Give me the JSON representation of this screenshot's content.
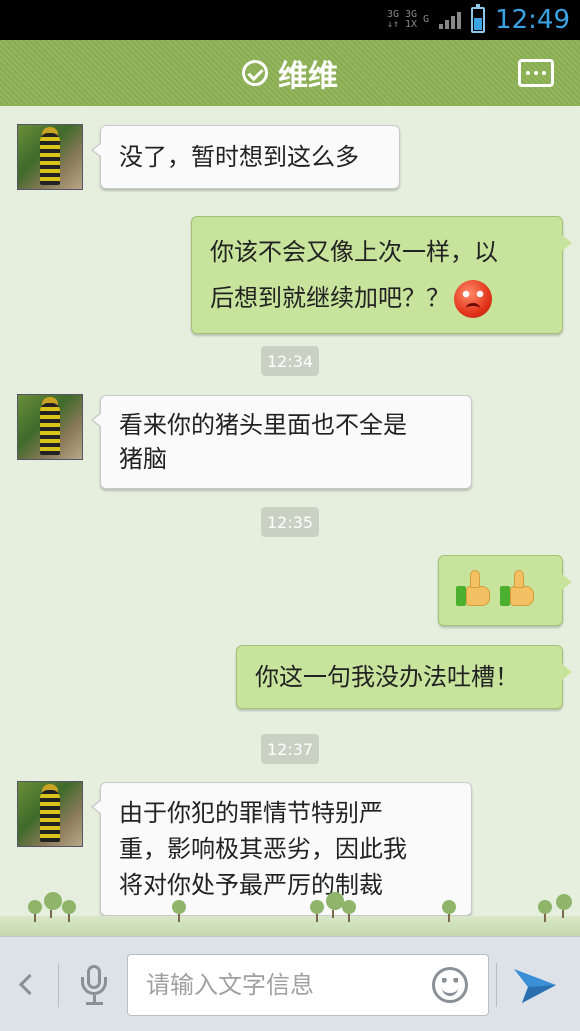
{
  "status_bar": {
    "network_labels": [
      "3G",
      "3G",
      "1X",
      "G"
    ],
    "battery_level": 0.55,
    "time": "12:49",
    "accent_color": "#3aa3e3"
  },
  "header": {
    "title": "维维",
    "verified_icon": "check-circle-icon",
    "menu_icon": "more-options-icon",
    "bg_color": "#8db255"
  },
  "messages": [
    {
      "side": "left",
      "text": "没了，暂时想到这么多"
    },
    {
      "side": "right",
      "text": "你该不会又像上次一样，以后想到就继续加吧？？",
      "line1": "你该不会又像上次一样，以",
      "line2": "后想到就继续加吧？？",
      "emoji": "angry-face-icon"
    },
    {
      "type": "time",
      "text": "12:34"
    },
    {
      "side": "left",
      "text": "看来你的猪头里面也不全是猪脑",
      "line1": "看来你的猪头里面也不全是",
      "line2": "猪脑"
    },
    {
      "type": "time",
      "text": "12:35"
    },
    {
      "side": "right",
      "emoji": [
        "thumbs-up-icon",
        "thumbs-up-icon"
      ]
    },
    {
      "side": "right",
      "text": "你这一句我没办法吐槽！"
    },
    {
      "type": "time",
      "text": "12:37"
    },
    {
      "side": "left",
      "text": "由于你犯的罪情节特别严重，影响极其恶劣，因此我将对你处予最严厉的制裁",
      "line1": "由于你犯的罪情节特别严",
      "line2": "重，影响极其恶劣，因此我",
      "line3": "将对你处予最严厉的制裁"
    }
  ],
  "input_bar": {
    "placeholder": "请输入文字信息",
    "value": "",
    "back_icon": "chevron-left-icon",
    "voice_icon": "microphone-icon",
    "emoji_icon": "smiley-icon",
    "send_icon": "send-icon",
    "send_color": "#3a8fd6"
  }
}
